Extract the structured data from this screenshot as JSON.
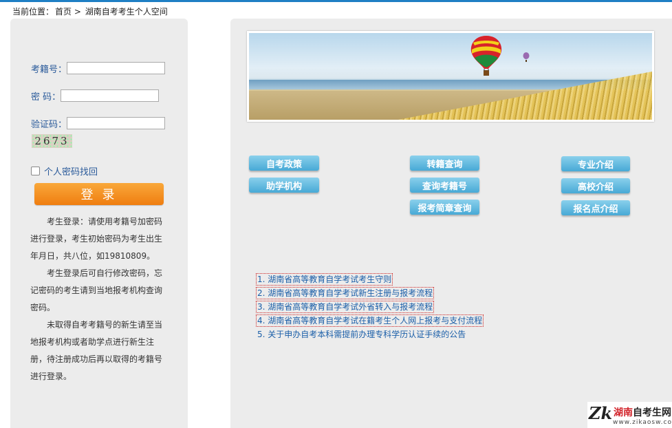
{
  "breadcrumb": {
    "prefix": "当前位置：",
    "home": "首页",
    "sep": ">",
    "current": "湖南自考考生个人空间"
  },
  "login": {
    "exam_no_label": "考籍号：",
    "password_label": "密 码：",
    "captcha_label": "验证码：",
    "captcha_value": "2673",
    "remember_label": "个人密码找回",
    "submit_label": "登 录",
    "notes": [
      "考生登录：请使用考籍号加密码进行登录，考生初始密码为考生出生年月日，共八位，如19810809。",
      "考生登录后可自行修改密码，忘记密码的考生请到当地报考机构查询密码。",
      "未取得自考考籍号的新生请至当地报考机构或者助学点进行新生注册，待注册成功后再以取得的考籍号进行登录。"
    ]
  },
  "nav": {
    "col1": [
      "自考政策",
      "助学机构"
    ],
    "col2": [
      "转籍查询",
      "查询考籍号",
      "报考简章查询"
    ],
    "col3": [
      "专业介绍",
      "高校介绍",
      "报名点介绍"
    ]
  },
  "links": [
    "1. 湖南省高等教育自学考试考生守则",
    "2. 湖南省高等教育自学考试新生注册与报考流程",
    "3. 湖南省高等教育自学考试外省转入与报考流程",
    "4. 湖南省高等教育自学考试在籍考生个人网上报考与支付流程",
    "5. 关于申办自考本科需提前办理专科学历认证手续的公告"
  ],
  "logo": {
    "mark": "Zk",
    "name_prefix": "湖南",
    "name_suffix": "自考生网",
    "url": "www.zikaosw.com"
  },
  "colors": {
    "accent": "#1f7fc4",
    "login_button": "#ef7d10",
    "nav_button": "#47a9d6",
    "link": "#1a5ea8"
  }
}
